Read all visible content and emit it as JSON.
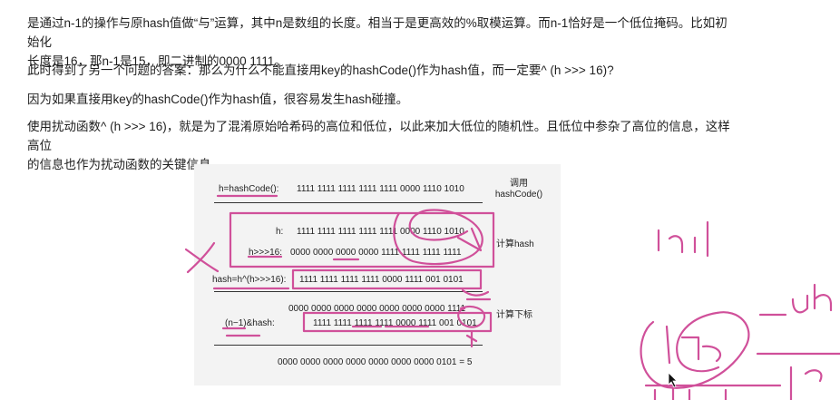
{
  "paragraphs": {
    "p1_line1": "是通过n-1的操作与原hash值做“与”运算，其中n是数组的长度。相当于是更高效的%取模运算。而n-1恰好是一个低位掩码。比如初始化",
    "p1_line2": "长度是16，那n-1是15，即二进制的0000 1111。",
    "p2": "此时得到了另一个问题的答案：那么为什么不能直接用key的hashCode()作为hash值，而一定要^ (h >>> 16)?",
    "p3": "因为如果直接用key的hashCode()作为hash值，很容易发生hash碰撞。",
    "p4_line1": "使用扰动函数^ (h >>> 16)，就是为了混淆原始哈希码的高位和低位，以此来加大低位的随机性。且低位中参杂了高位的信息，这样高位",
    "p4_line2": "的信息也作为扰动函数的关键信息。"
  },
  "figure": {
    "row1_label": "h=hashCode():",
    "row1_bits": "1111 1111 1111 1111 1111 0000 1110 1010",
    "row1_note_line1": "调用",
    "row1_note_line2": "hashCode()",
    "row2_label": "h:",
    "row2_bits": "1111 1111 1111 1111 1111 0000 1110 1010",
    "row3_label": "h>>>16:",
    "row3_bits": "0000 0000 0000 0000 1111 1111 1111 1111",
    "row23_note": "计算hash",
    "row4_label": "hash=h^(h>>>16):",
    "row4_bits": "1111 1111 1111 1111 0000 1111 001 0101",
    "row5_bits": "0000 0000 0000 0000 0000 0000 0000 1111",
    "row6_label": "(n−1)&hash:",
    "row6_bits": "1111 1111 1111 1111 0000 1111 001 0101",
    "row56_note": "计算下标",
    "result": "0000 0000 0000 0000 0000 0000 0000 0101 = 5"
  },
  "colors": {
    "ink": "#d0509a",
    "text": "#1f1f1f",
    "figure_bg": "#f3f3f3"
  }
}
